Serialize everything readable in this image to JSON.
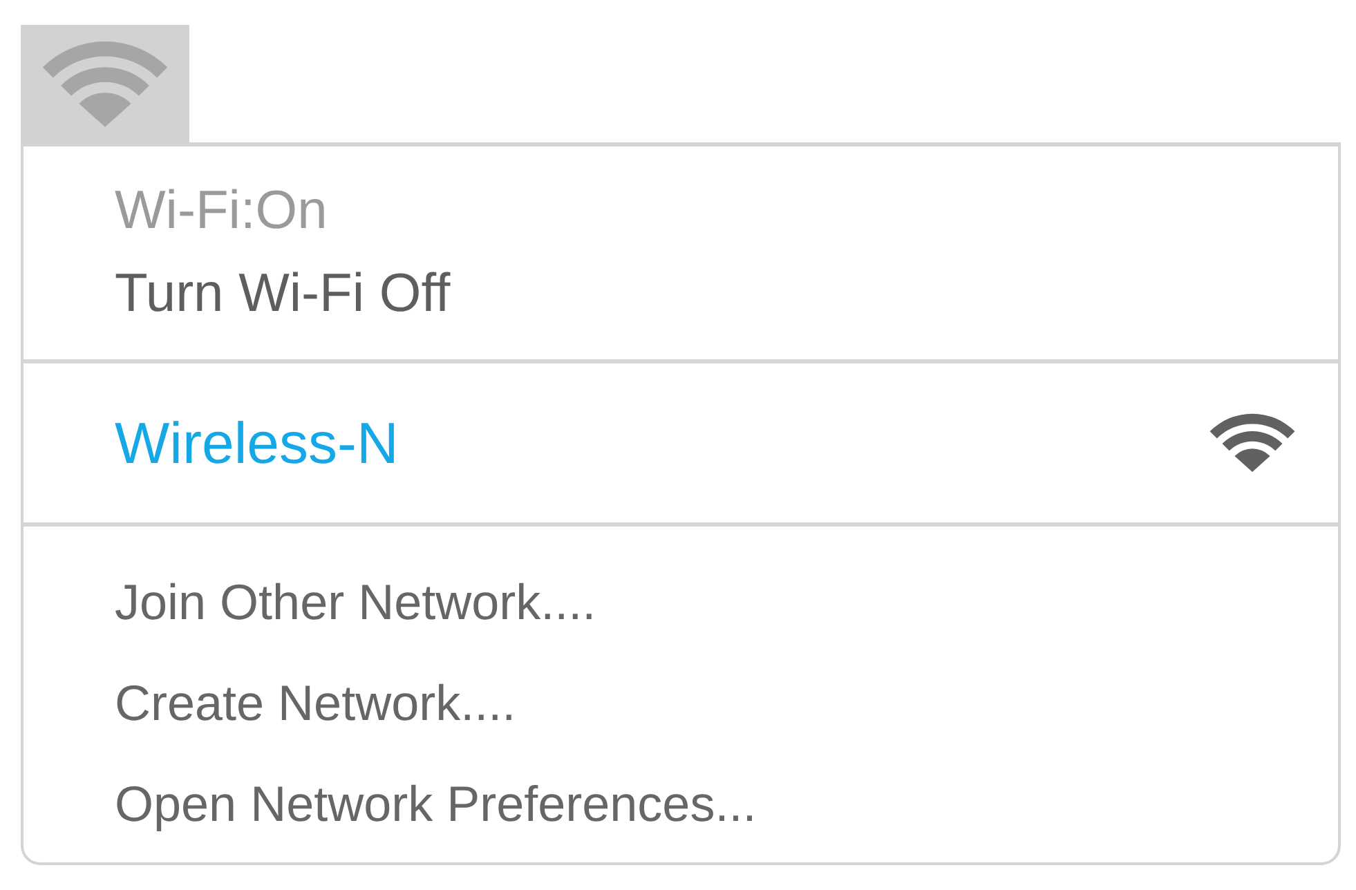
{
  "status_items": [
    {
      "label": "Wi-Fi:On",
      "disabled": true
    },
    {
      "label": "Turn Wi-Fi Off",
      "disabled": false
    }
  ],
  "networks": [
    {
      "name": "Wireless-N",
      "selected": true
    }
  ],
  "actions": [
    "Join Other Network....",
    "Create Network....",
    "Open Network Preferences..."
  ]
}
